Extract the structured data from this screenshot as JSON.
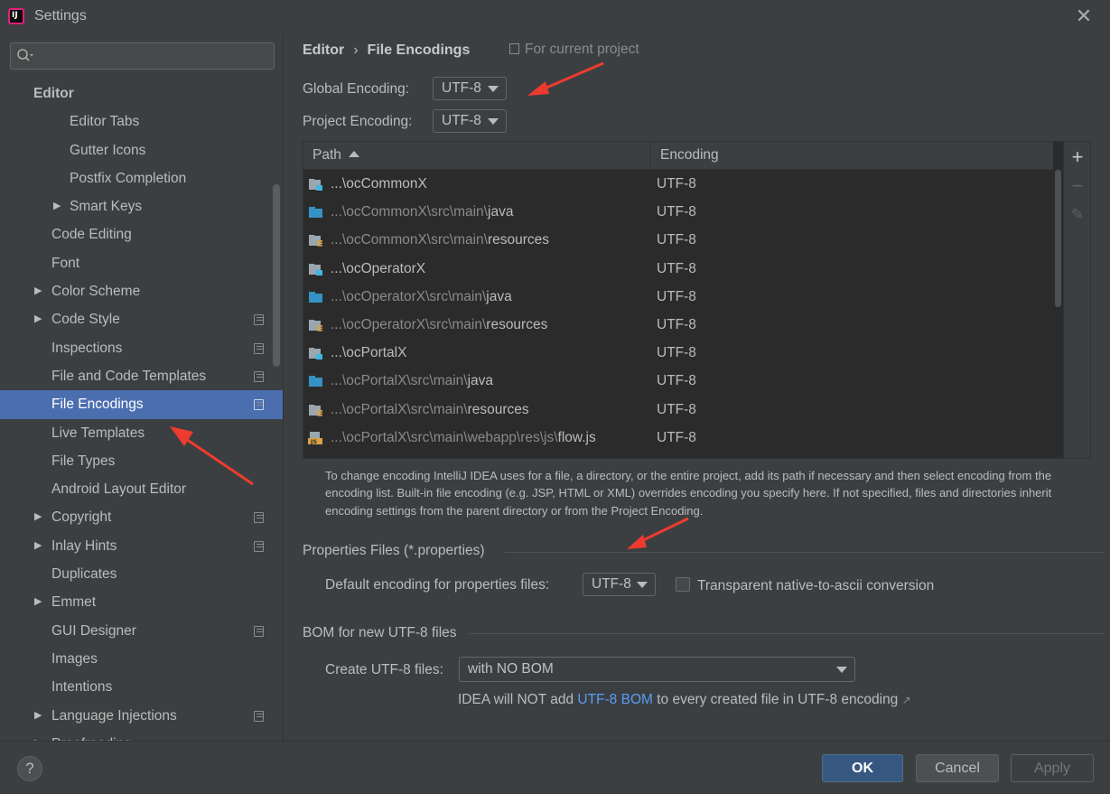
{
  "window": {
    "title": "Settings",
    "app_icon_text": "IJ",
    "close_glyph": "✕"
  },
  "sidebar": {
    "search_placeholder": "",
    "items": [
      {
        "label": "Editor",
        "bold": true
      },
      {
        "label": "Editor Tabs"
      },
      {
        "label": "Gutter Icons"
      },
      {
        "label": "Postfix Completion"
      },
      {
        "label": "Smart Keys",
        "expandable": true
      },
      {
        "label": "Code Editing"
      },
      {
        "label": "Font"
      },
      {
        "label": "Color Scheme",
        "expandable": true
      },
      {
        "label": "Code Style",
        "expandable": true,
        "project": true
      },
      {
        "label": "Inspections",
        "project": true
      },
      {
        "label": "File and Code Templates",
        "project": true
      },
      {
        "label": "File Encodings",
        "project": true,
        "selected": true
      },
      {
        "label": "Live Templates"
      },
      {
        "label": "File Types"
      },
      {
        "label": "Android Layout Editor"
      },
      {
        "label": "Copyright",
        "expandable": true,
        "project": true
      },
      {
        "label": "Inlay Hints",
        "expandable": true,
        "project": true
      },
      {
        "label": "Duplicates"
      },
      {
        "label": "Emmet",
        "expandable": true
      },
      {
        "label": "GUI Designer",
        "project": true
      },
      {
        "label": "Images"
      },
      {
        "label": "Intentions"
      },
      {
        "label": "Language Injections",
        "expandable": true,
        "project": true
      },
      {
        "label": "Proofreading",
        "expandable": true
      }
    ]
  },
  "breadcrumb": {
    "parent": "Editor",
    "separator": "›",
    "current": "File Encodings",
    "scope": "For current project"
  },
  "global_encoding": {
    "label": "Global Encoding:",
    "value": "UTF-8"
  },
  "project_encoding": {
    "label": "Project Encoding:",
    "value": "UTF-8"
  },
  "table": {
    "columns": [
      "Path",
      "Encoding"
    ],
    "rows": [
      {
        "prefix": "...\\",
        "name": "ocCommonX",
        "encoding": "UTF-8",
        "icon": "module-icon"
      },
      {
        "prefix": "...\\ocCommonX\\src\\main\\",
        "name": "java",
        "encoding": "UTF-8",
        "icon": "source-folder-icon"
      },
      {
        "prefix": "...\\ocCommonX\\src\\main\\",
        "name": "resources",
        "encoding": "UTF-8",
        "icon": "resources-folder-icon"
      },
      {
        "prefix": "...\\",
        "name": "ocOperatorX",
        "encoding": "UTF-8",
        "icon": "module-icon"
      },
      {
        "prefix": "...\\ocOperatorX\\src\\main\\",
        "name": "java",
        "encoding": "UTF-8",
        "icon": "source-folder-icon"
      },
      {
        "prefix": "...\\ocOperatorX\\src\\main\\",
        "name": "resources",
        "encoding": "UTF-8",
        "icon": "resources-folder-icon"
      },
      {
        "prefix": "...\\",
        "name": "ocPortalX",
        "encoding": "UTF-8",
        "icon": "module-icon"
      },
      {
        "prefix": "...\\ocPortalX\\src\\main\\",
        "name": "java",
        "encoding": "UTF-8",
        "icon": "source-folder-icon"
      },
      {
        "prefix": "...\\ocPortalX\\src\\main\\",
        "name": "resources",
        "encoding": "UTF-8",
        "icon": "resources-folder-icon"
      },
      {
        "prefix": "...\\ocPortalX\\src\\main\\webapp\\res\\js\\",
        "name": "flow.js",
        "encoding": "UTF-8",
        "icon": "js-file-icon"
      }
    ],
    "buttons": {
      "add": "+",
      "remove": "−",
      "edit": "✎"
    }
  },
  "help_text": "To change encoding IntelliJ IDEA uses for a file, a directory, or the entire project, add its path if necessary and then select encoding from the encoding list. Built-in file encoding (e.g. JSP, HTML or XML) overrides encoding you specify here. If not specified, files and directories inherit encoding settings from the parent directory or from the Project Encoding.",
  "properties": {
    "section": "Properties Files (*.properties)",
    "default_label": "Default encoding for properties files:",
    "default_value": "UTF-8",
    "transparent_label": "Transparent native-to-ascii conversion",
    "transparent_checked": false
  },
  "bom": {
    "section": "BOM for new UTF-8 files",
    "create_label": "Create UTF-8 files:",
    "create_value": "with NO BOM",
    "note_before": "IDEA will NOT add",
    "note_link": "UTF-8 BOM",
    "note_after": "to every created file in UTF-8 encoding",
    "note_arrow": "↗"
  },
  "footer": {
    "help": "?",
    "ok": "OK",
    "cancel": "Cancel",
    "apply": "Apply"
  },
  "colors": {
    "accent": "#4b6eaf",
    "link": "#589df6",
    "annotation": "#ee3b2f"
  }
}
